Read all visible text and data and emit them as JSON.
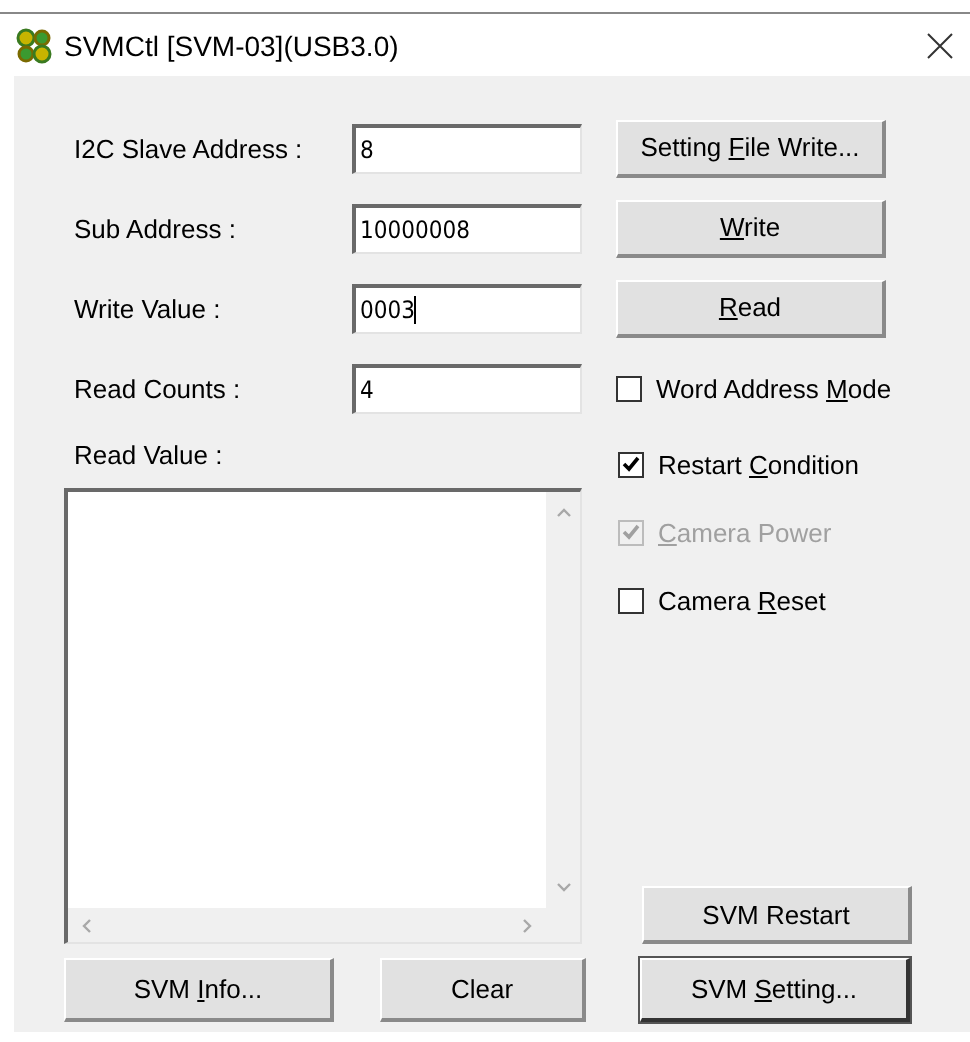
{
  "window": {
    "title": "SVMCtl [SVM-03](USB3.0)"
  },
  "fields": [
    {
      "label": "I2C Slave Address :",
      "value": "8",
      "focused": false
    },
    {
      "label": "Sub Address :",
      "value": "10000008",
      "focused": false
    },
    {
      "label": "Write Value :",
      "value": "0003",
      "focused": true
    },
    {
      "label": "Read Counts :",
      "value": "4",
      "focused": false
    }
  ],
  "side_buttons": [
    {
      "label_parts": [
        {
          "text": "Setting ",
          "underlined": false
        },
        {
          "text": "F",
          "underlined": true
        },
        {
          "text": "ile Write...",
          "underlined": false
        }
      ]
    },
    {
      "label_parts": [
        {
          "text": "W",
          "underlined": true
        },
        {
          "text": "rite",
          "underlined": false
        }
      ]
    },
    {
      "label_parts": [
        {
          "text": "R",
          "underlined": true
        },
        {
          "text": "ead",
          "underlined": false
        }
      ]
    }
  ],
  "checkboxes": [
    {
      "label_parts": [
        {
          "text": "Word Address ",
          "underlined": false
        },
        {
          "text": "M",
          "underlined": true
        },
        {
          "text": "ode",
          "underlined": false
        }
      ],
      "checked": false,
      "disabled": false
    },
    {
      "label_parts": [
        {
          "text": "Restart ",
          "underlined": false
        },
        {
          "text": "C",
          "underlined": true
        },
        {
          "text": "ondition",
          "underlined": false
        }
      ],
      "checked": true,
      "disabled": false
    },
    {
      "label_parts": [
        {
          "text": "C",
          "underlined": true
        },
        {
          "text": "amera Power",
          "underlined": false
        }
      ],
      "checked": true,
      "disabled": true
    },
    {
      "label_parts": [
        {
          "text": "Camera ",
          "underlined": false
        },
        {
          "text": "R",
          "underlined": true
        },
        {
          "text": "eset",
          "underlined": false
        }
      ],
      "checked": false,
      "disabled": false
    }
  ],
  "read_value": {
    "label": "Read Value :"
  },
  "restart_button": {
    "label_parts": [
      {
        "text": "SVM Restart",
        "underlined": false
      }
    ]
  },
  "bottom_buttons": [
    {
      "label_parts": [
        {
          "text": "SVM ",
          "underlined": false
        },
        {
          "text": "I",
          "underlined": true
        },
        {
          "text": "nfo...",
          "underlined": false
        }
      ],
      "default": false
    },
    {
      "label_parts": [
        {
          "text": "Clear",
          "underlined": false
        }
      ],
      "default": false
    },
    {
      "label_parts": [
        {
          "text": "SVM ",
          "underlined": false
        },
        {
          "text": "S",
          "underlined": true
        },
        {
          "text": "etting...",
          "underlined": false
        }
      ],
      "default": true
    }
  ]
}
